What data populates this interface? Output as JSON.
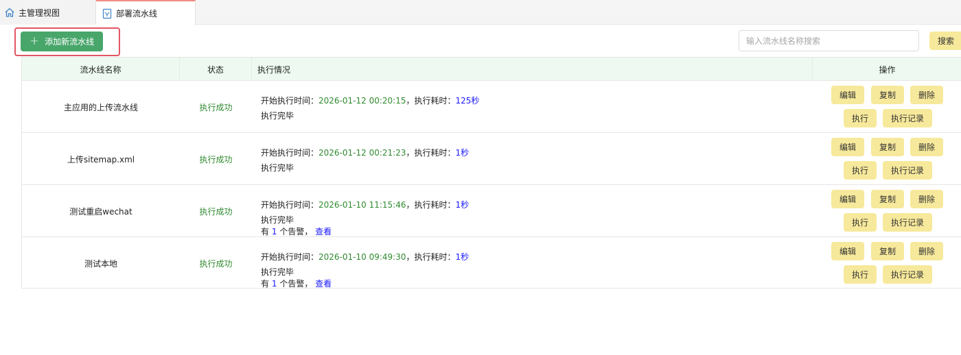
{
  "tabs": [
    {
      "label": "主管理视图",
      "icon": "home-icon"
    },
    {
      "label": "部署流水线",
      "icon": "document-icon"
    }
  ],
  "toolbar": {
    "add_label": "添加新流水线",
    "search_placeholder": "输入流水线名称搜索",
    "search_label": "搜索"
  },
  "table": {
    "headers": {
      "name": "流水线名称",
      "status": "状态",
      "exec": "执行情况",
      "ops": "操作"
    },
    "exec_labels": {
      "start": "开始执行时间：",
      "sep": "，执行耗时：",
      "done": "执行完毕",
      "alert_prefix": "有",
      "alert_suffix": "个告警，",
      "view": "查看"
    },
    "actions": {
      "edit": "编辑",
      "copy": "复制",
      "delete": "删除",
      "run": "执行",
      "log": "执行记录"
    },
    "rows": [
      {
        "name": "主应用的上传流水线",
        "status": "执行成功",
        "start_time": "2026-01-12 00:20:15",
        "duration": "125秒",
        "alerts": ""
      },
      {
        "name": "上传sitemap.xml",
        "status": "执行成功",
        "start_time": "2026-01-12 00:21:23",
        "duration": "1秒",
        "alerts": ""
      },
      {
        "name": "测试重启wechat",
        "status": "执行成功",
        "start_time": "2026-01-10 11:15:46",
        "duration": "1秒",
        "alerts": "1"
      },
      {
        "name": "测试本地",
        "status": "执行成功",
        "start_time": "2026-01-10 09:49:30",
        "duration": "1秒",
        "alerts": "1"
      }
    ]
  }
}
